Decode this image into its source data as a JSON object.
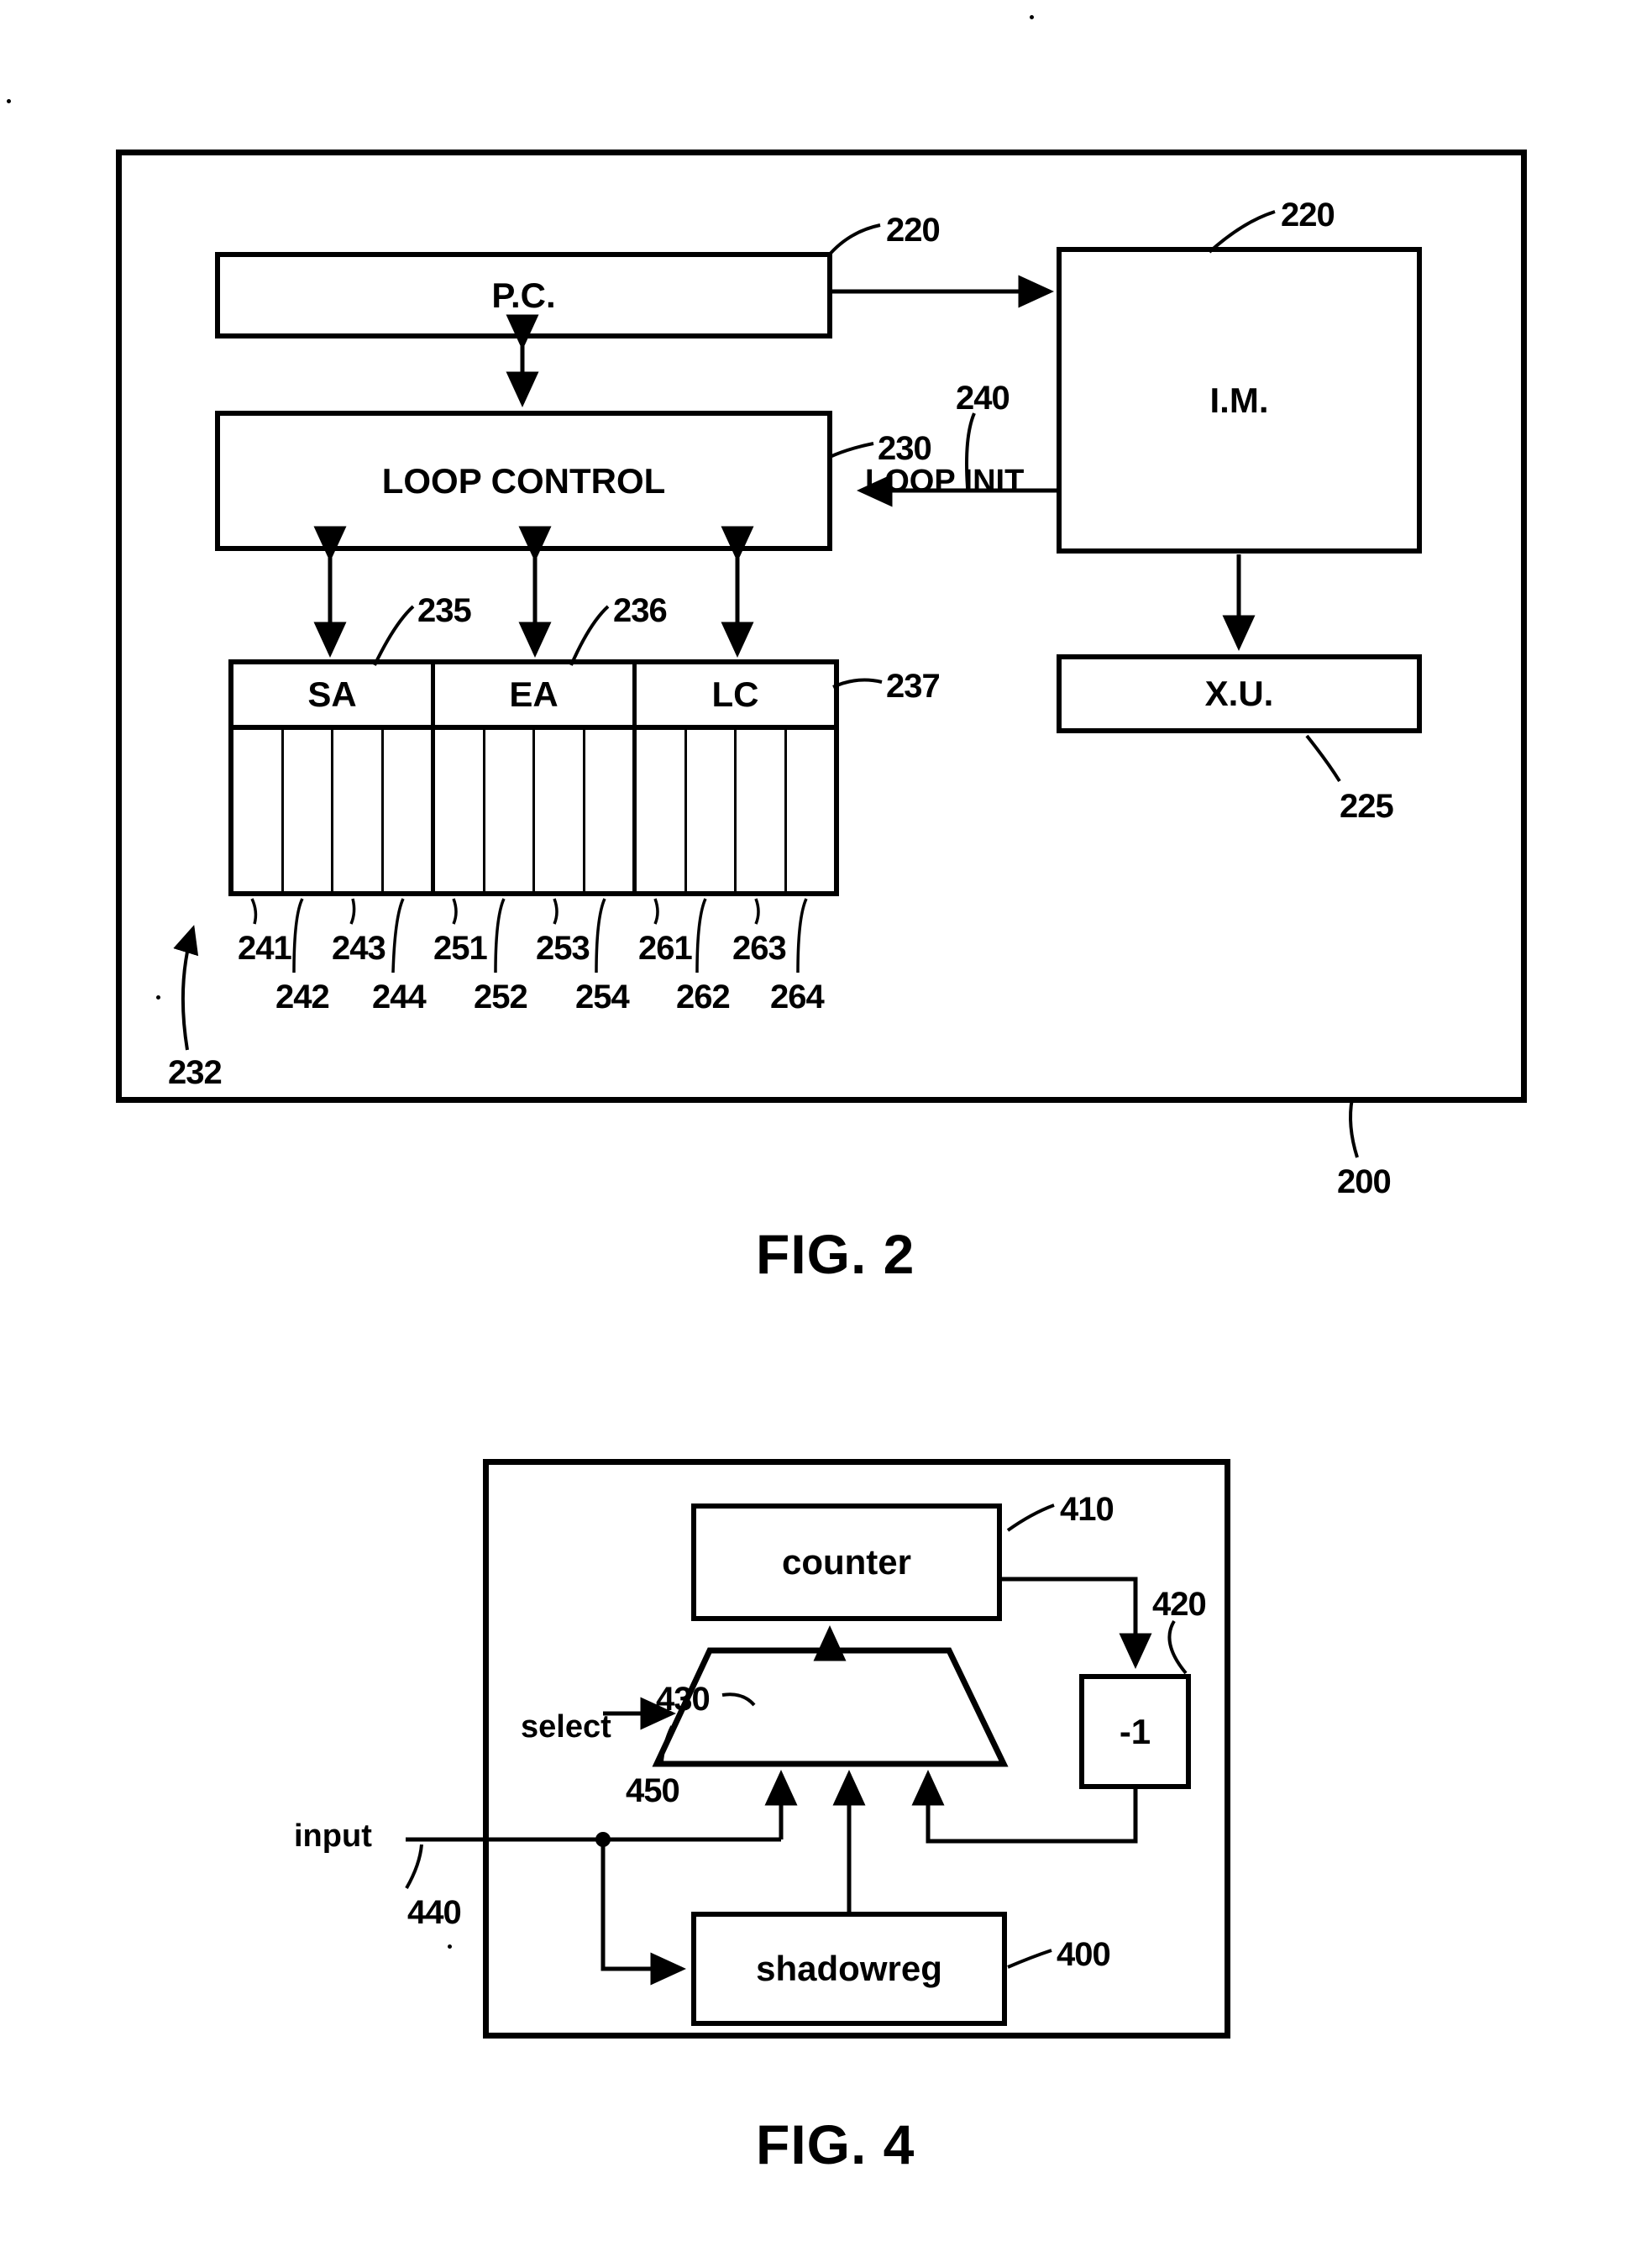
{
  "page": {
    "figures": [
      {
        "caption": "FIG. 2",
        "outer_ref": "200",
        "blocks": [
          {
            "name": "program-counter",
            "label": "P.C.",
            "ref": "220"
          },
          {
            "name": "loop-control",
            "label": "LOOP CONTROL",
            "ref": "230"
          },
          {
            "name": "instruction-memory",
            "label": "I.M.",
            "ref": "220"
          },
          {
            "name": "execution-unit",
            "label": "X.U.",
            "ref": "225"
          }
        ],
        "signals": [
          {
            "name": "loop-init",
            "label": "LOOP INIT",
            "ref": "240"
          }
        ],
        "register_table": {
          "ref": "237",
          "table_ref": "232",
          "columns": [
            "SA",
            "EA",
            "LC"
          ],
          "column_refs": [
            "235",
            "236",
            ""
          ],
          "cell_refs_top": [
            "241",
            "243",
            "251",
            "253",
            "261",
            "263"
          ],
          "cell_refs_bottom": [
            "242",
            "244",
            "252",
            "254",
            "262",
            "264"
          ],
          "cells_per_column": 4
        }
      },
      {
        "caption": "FIG. 4",
        "blocks": [
          {
            "name": "counter",
            "label": "counter",
            "ref": "410"
          },
          {
            "name": "decrementer",
            "label": "-1",
            "ref": "420"
          },
          {
            "name": "shadow-register",
            "label": "shadowreg",
            "ref": "400"
          },
          {
            "name": "multiplexer",
            "label": "",
            "ref": "430"
          }
        ],
        "signals": [
          {
            "name": "select-signal",
            "label": "select",
            "ref": ""
          },
          {
            "name": "input-signal",
            "label": "input",
            "ref": "440"
          },
          {
            "name": "mux-inputs-bus",
            "label": "",
            "ref": "450"
          }
        ]
      }
    ]
  },
  "colors": {
    "ink": "#000000",
    "paper": "#ffffff"
  }
}
